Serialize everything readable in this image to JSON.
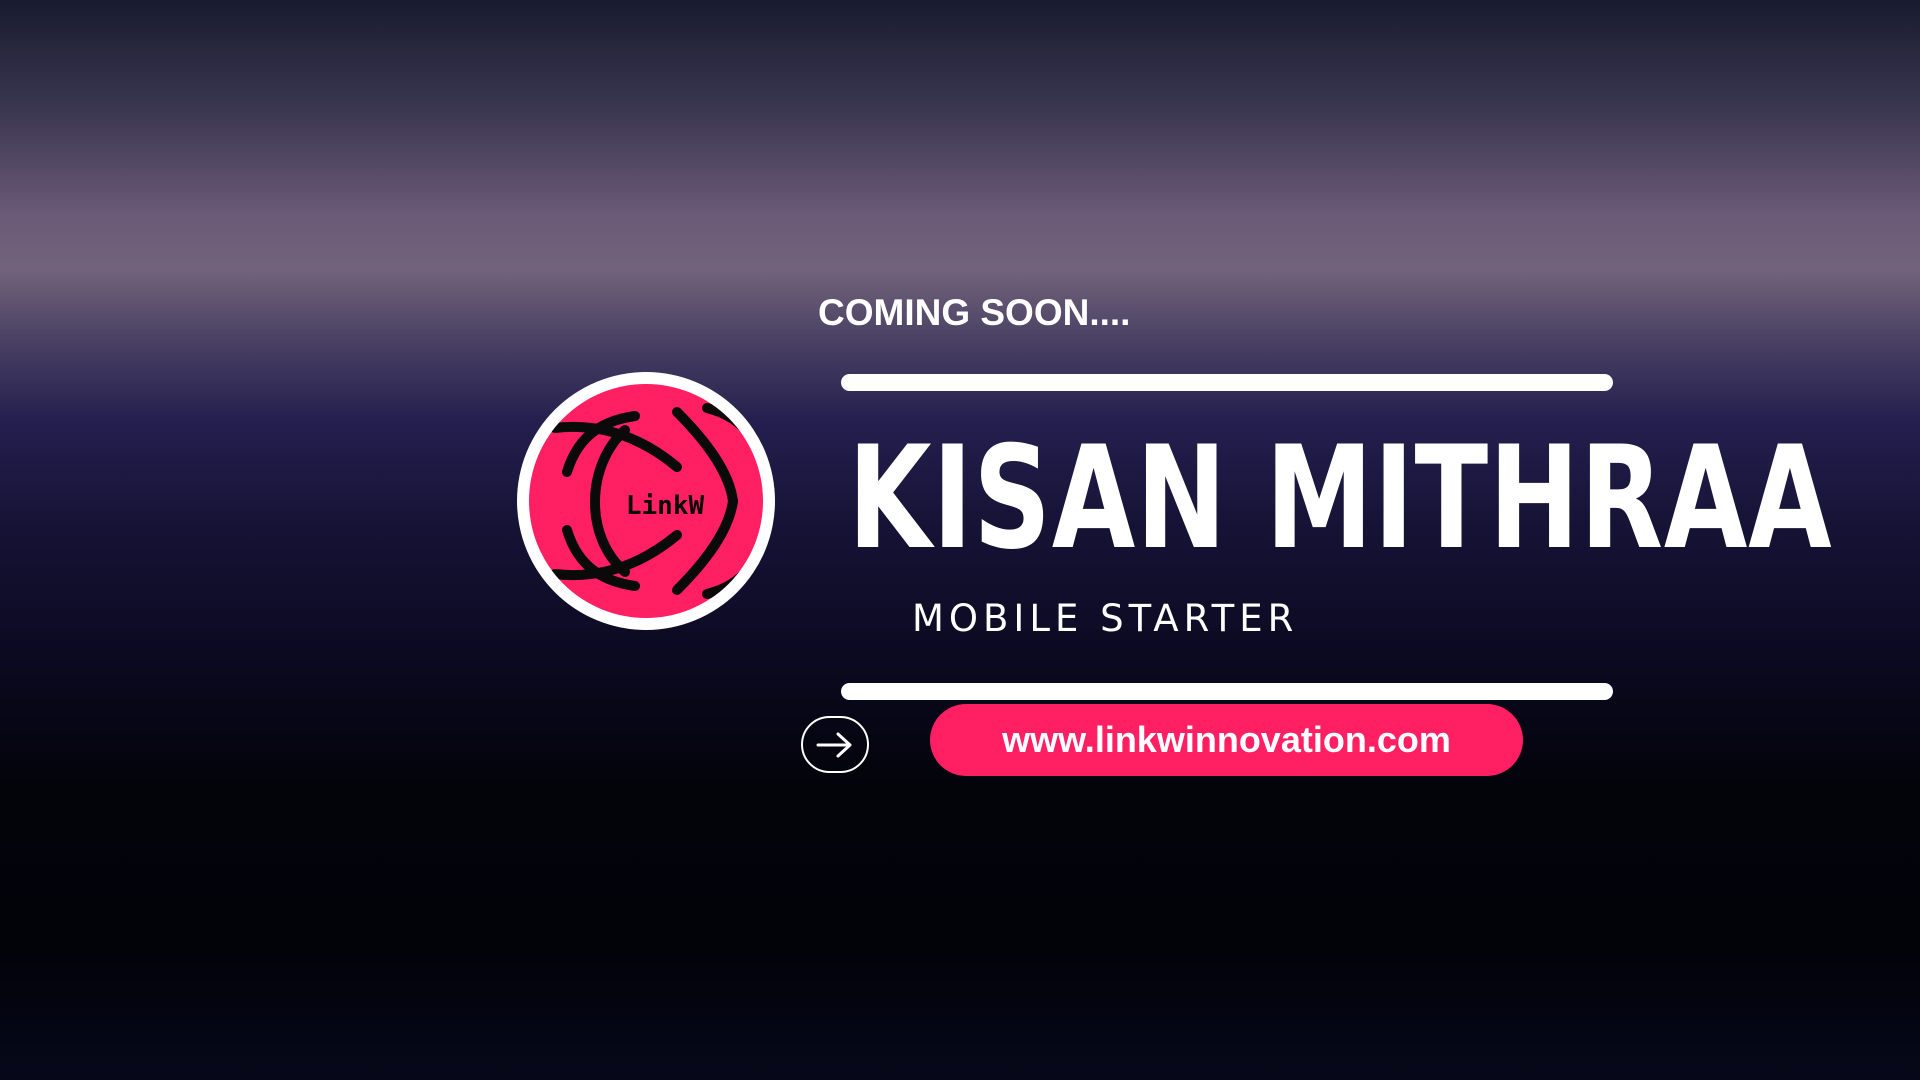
{
  "announcement": {
    "coming_soon": "COMING SOON...."
  },
  "logo": {
    "text": "LinkW",
    "icon": "linkw-logo-icon",
    "brand_color": "#ff1f62"
  },
  "product": {
    "title": "KISAN MITHRAA",
    "subtitle": "MOBILE STARTER"
  },
  "link": {
    "arrow_icon": "arrow-right-icon",
    "url": "www.linkwinnovation.com",
    "pill_color": "#ff1f62"
  }
}
